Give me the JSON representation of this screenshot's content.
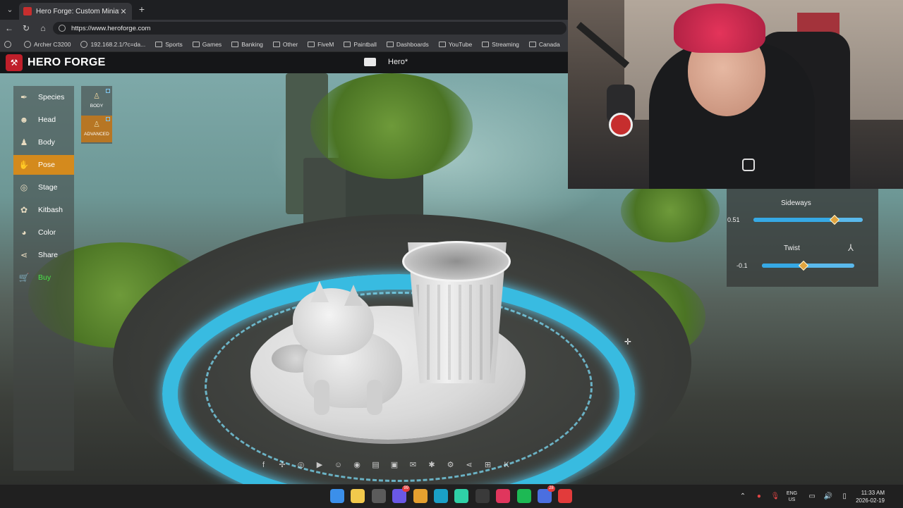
{
  "browser": {
    "tab": {
      "title": "Hero Forge: Custom Miniatures"
    },
    "url": "https://www.heroforge.com",
    "bookmarks": [
      "Archer C3200",
      "192.168.2.1/?c=da...",
      "Sports",
      "Games",
      "Banking",
      "Other",
      "FiveM",
      "Paintball",
      "Dashboards",
      "YouTube",
      "Streaming",
      "Canada"
    ]
  },
  "app": {
    "logo_text": "HERO FORGE",
    "project_title": "Hero*"
  },
  "menu": [
    {
      "label": "Species",
      "icon": "species-icon",
      "glyph": "✒"
    },
    {
      "label": "Head",
      "icon": "head-icon",
      "glyph": "☻"
    },
    {
      "label": "Body",
      "icon": "body-icon",
      "glyph": "♟"
    },
    {
      "label": "Pose",
      "icon": "pose-icon",
      "glyph": "✋",
      "active": true
    },
    {
      "label": "Stage",
      "icon": "stage-icon",
      "glyph": "◎"
    },
    {
      "label": "Kitbash",
      "icon": "kitbash-icon",
      "glyph": "✿"
    },
    {
      "label": "Color",
      "icon": "color-palette-icon",
      "glyph": "◕"
    },
    {
      "label": "Share",
      "icon": "share-icon",
      "glyph": "⋖"
    },
    {
      "label": "Buy",
      "icon": "cart-icon",
      "glyph": "🛒"
    }
  ],
  "pose_sub": {
    "body_label": "BODY",
    "advanced_label": "ADVANCED"
  },
  "pose_panel": {
    "sideways": {
      "label": "Sideways",
      "value": "0.51",
      "level": 0.74
    },
    "twist": {
      "label": "Twist",
      "value": "-0.1",
      "level": 0.45
    }
  },
  "share_icons": [
    "facebook-icon",
    "bluesky-icon",
    "instagram-icon",
    "youtube-icon",
    "discord-icon",
    "reddit-icon",
    "twitch-icon",
    "store-icon",
    "mail-icon",
    "bug-icon",
    "settings-icon",
    "share-icon",
    "gift-icon",
    "kickstarter-icon"
  ],
  "taskbar": {
    "apps": [
      {
        "name": "windows-start-icon",
        "color": "#3b8fea"
      },
      {
        "name": "file-explorer-icon",
        "color": "#f2c94c"
      },
      {
        "name": "store-icon",
        "color": "#5b5b5b"
      },
      {
        "name": "discord-icon",
        "color": "#6a58e6",
        "badge": "99"
      },
      {
        "name": "chrome-icon",
        "color": "#e5a02f"
      },
      {
        "name": "edge-icon",
        "color": "#1aa0c7"
      },
      {
        "name": "streamlabs-icon",
        "color": "#2fd1a7"
      },
      {
        "name": "obs-icon",
        "color": "#3a3a3a"
      },
      {
        "name": "app-icon",
        "color": "#e0365d"
      },
      {
        "name": "spotify-icon",
        "color": "#1db954"
      },
      {
        "name": "teams-icon",
        "color": "#4b6fe0",
        "badge": "28"
      },
      {
        "name": "record-icon",
        "color": "#e23b3b"
      }
    ],
    "lang_top": "ENG",
    "lang_bottom": "US",
    "time": "11:33 AM",
    "date": "2026-02-19"
  }
}
